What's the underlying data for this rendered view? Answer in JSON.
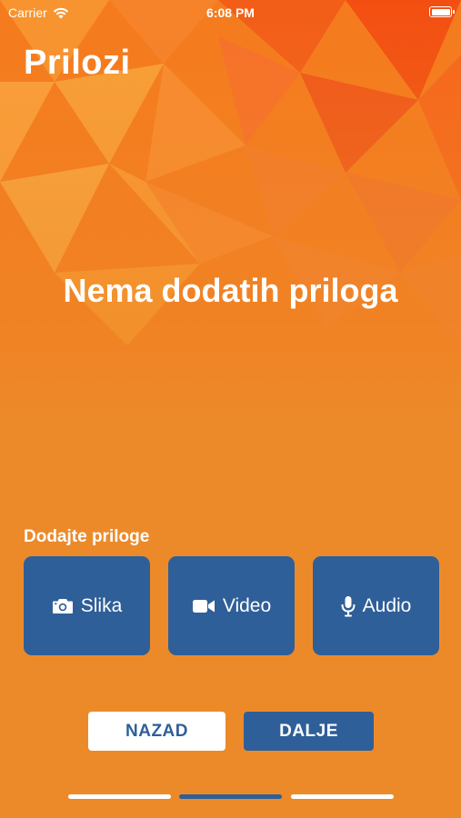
{
  "status_bar": {
    "carrier": "Carrier",
    "time": "6:08 PM"
  },
  "header": {
    "title": "Prilozi"
  },
  "empty_state": {
    "message": "Nema dodatih priloga"
  },
  "attachments": {
    "label": "Dodajte priloge",
    "buttons": [
      {
        "label": "Slika",
        "icon": "camera-icon"
      },
      {
        "label": "Video",
        "icon": "video-camera-icon"
      },
      {
        "label": "Audio",
        "icon": "microphone-icon"
      }
    ]
  },
  "navigation": {
    "back_label": "NAZAD",
    "next_label": "DALJE"
  },
  "progress": {
    "steps": 3,
    "current_step": 2
  },
  "colors": {
    "background": "#ec8a2a",
    "accent_blue": "#2f5f98",
    "text": "#ffffff"
  }
}
